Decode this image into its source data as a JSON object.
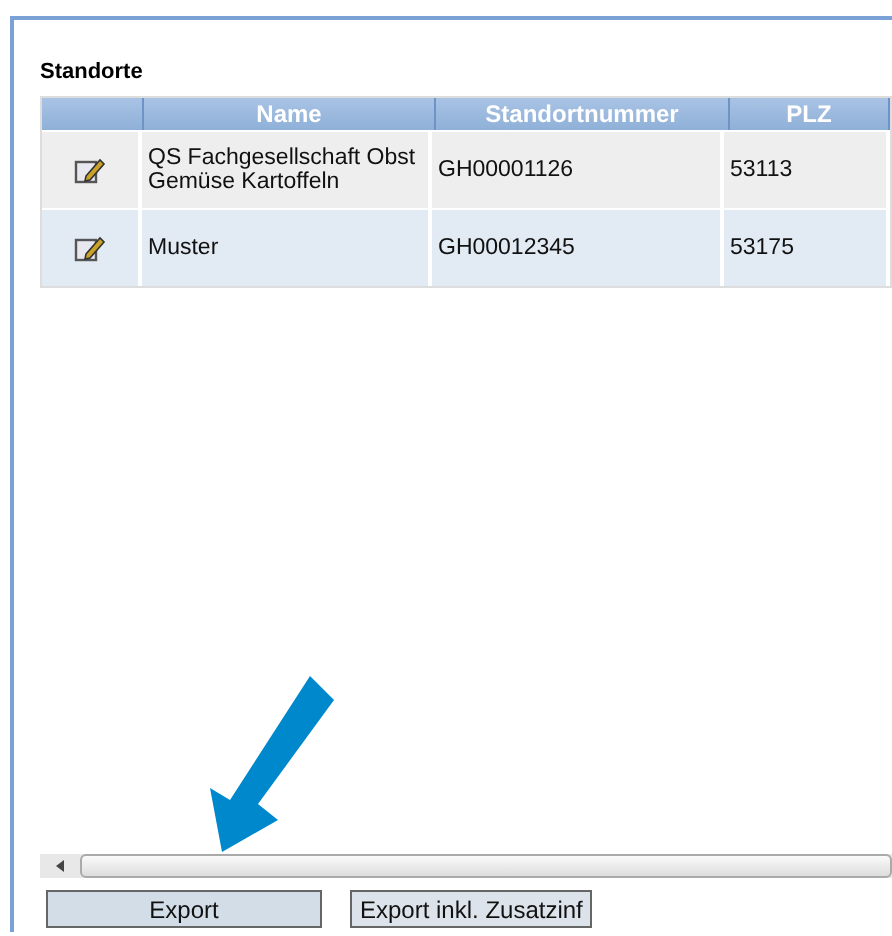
{
  "section_title": "Standorte",
  "table": {
    "columns": [
      "",
      "Name",
      "Standortnummer",
      "PLZ"
    ],
    "rows": [
      {
        "name": "QS Fachgesellschaft Obst Gemüse Kartoffeln",
        "number": "GH00001126",
        "plz": "53113"
      },
      {
        "name": "Muster",
        "number": "GH00012345",
        "plz": "53175"
      }
    ]
  },
  "buttons": [
    "Export",
    "Export inkl. Zusatzinf"
  ]
}
